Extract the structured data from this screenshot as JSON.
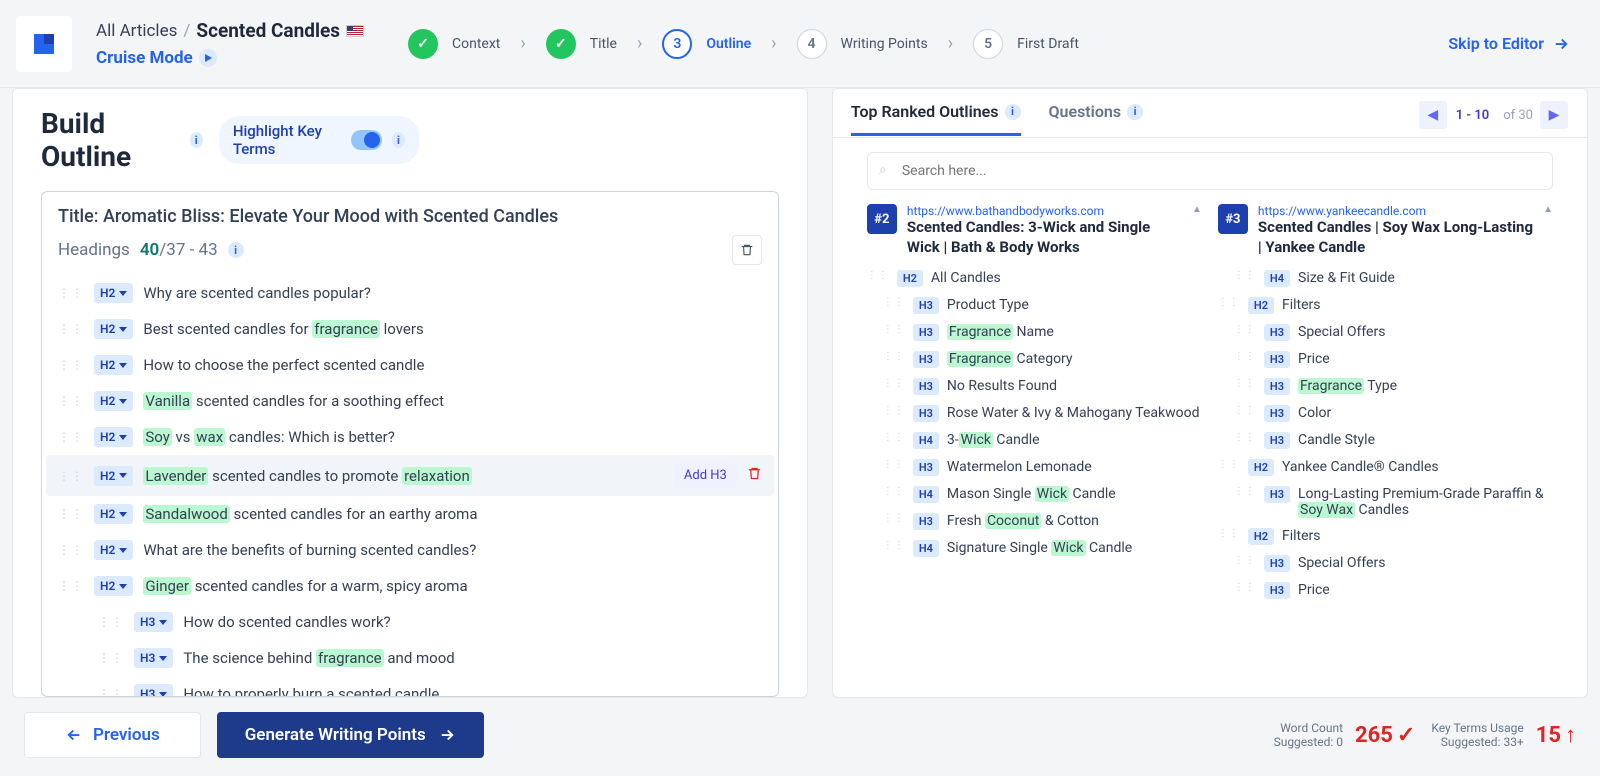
{
  "header": {
    "breadcrumb_root": "All Articles",
    "breadcrumb_title": "Scented Candles",
    "cruise": "Cruise Mode",
    "skip": "Skip to Editor"
  },
  "steps": [
    {
      "label": "Context",
      "state": "done",
      "num": "✓"
    },
    {
      "label": "Title",
      "state": "done",
      "num": "✓"
    },
    {
      "label": "Outline",
      "state": "current",
      "num": "3"
    },
    {
      "label": "Writing Points",
      "state": "pending",
      "num": "4"
    },
    {
      "label": "First Draft",
      "state": "pending",
      "num": "5"
    }
  ],
  "left": {
    "panel_title": "Build Outline",
    "highlight_label": "Highlight Key Terms",
    "article_title": "Title: Aromatic Bliss: Elevate Your Mood with Scented Candles",
    "headings_label": "Headings",
    "headings_count": "40",
    "headings_range": "/37 - 43",
    "add_h3": "Add H3",
    "rows": [
      {
        "level": "H2",
        "indent": 0,
        "parts": [
          {
            "t": "Why are scented candles popular?"
          }
        ]
      },
      {
        "level": "H2",
        "indent": 0,
        "parts": [
          {
            "t": "Best scented candles for "
          },
          {
            "t": "fragrance",
            "hl": true
          },
          {
            "t": " lovers"
          }
        ]
      },
      {
        "level": "H2",
        "indent": 0,
        "parts": [
          {
            "t": "How to choose the perfect scented candle"
          }
        ]
      },
      {
        "level": "H2",
        "indent": 0,
        "parts": [
          {
            "t": "Vanilla",
            "hl": true
          },
          {
            "t": " scented candles for a soothing effect"
          }
        ]
      },
      {
        "level": "H2",
        "indent": 0,
        "parts": [
          {
            "t": "Soy",
            "hl": true
          },
          {
            "t": " vs "
          },
          {
            "t": "wax",
            "hl": true
          },
          {
            "t": " candles: Which is better?"
          }
        ]
      },
      {
        "level": "H2",
        "indent": 0,
        "hover": true,
        "parts": [
          {
            "t": "Lavender",
            "hl": true
          },
          {
            "t": " scented candles to promote "
          },
          {
            "t": "relaxation",
            "hl": true
          }
        ]
      },
      {
        "level": "H2",
        "indent": 0,
        "parts": [
          {
            "t": "Sandalwood",
            "hl": true
          },
          {
            "t": " scented candles for an earthy aroma"
          }
        ]
      },
      {
        "level": "H2",
        "indent": 0,
        "parts": [
          {
            "t": "What are the benefits of burning scented candles?"
          }
        ]
      },
      {
        "level": "H2",
        "indent": 0,
        "parts": [
          {
            "t": "Ginger",
            "hl": true
          },
          {
            "t": " scented candles for a warm, spicy aroma"
          }
        ]
      },
      {
        "level": "H3",
        "indent": 1,
        "parts": [
          {
            "t": "How do scented candles work?"
          }
        ]
      },
      {
        "level": "H3",
        "indent": 1,
        "parts": [
          {
            "t": "The science behind "
          },
          {
            "t": "fragrance",
            "hl": true
          },
          {
            "t": " and mood"
          }
        ]
      },
      {
        "level": "H3",
        "indent": 1,
        "parts": [
          {
            "t": "How to properly burn a scented candle"
          }
        ]
      }
    ]
  },
  "right": {
    "tab_outlines": "Top Ranked Outlines",
    "tab_questions": "Questions",
    "page_range": "1 - 10",
    "page_total": "of 30",
    "search_placeholder": "Search here...",
    "competitors": [
      {
        "rank": "#2",
        "url": "https://www.bathandbodyworks.com",
        "title": "Scented Candles: 3-Wick and Single Wick | Bath & Body Works",
        "rows": [
          {
            "lv": "H2",
            "ind": 1,
            "parts": [
              {
                "t": "All Candles"
              }
            ]
          },
          {
            "lv": "H3",
            "ind": 2,
            "parts": [
              {
                "t": "Product Type"
              }
            ]
          },
          {
            "lv": "H3",
            "ind": 2,
            "parts": [
              {
                "t": "Fragrance",
                "hl": true
              },
              {
                "t": " Name"
              }
            ]
          },
          {
            "lv": "H3",
            "ind": 2,
            "parts": [
              {
                "t": "Fragrance",
                "hl": true
              },
              {
                "t": " Category"
              }
            ]
          },
          {
            "lv": "H3",
            "ind": 2,
            "parts": [
              {
                "t": "No Results Found"
              }
            ]
          },
          {
            "lv": "H3",
            "ind": 2,
            "parts": [
              {
                "t": "Rose Water & Ivy & Mahogany Teakwood"
              }
            ]
          },
          {
            "lv": "H4",
            "ind": 2,
            "parts": [
              {
                "t": "3-"
              },
              {
                "t": "Wick",
                "hl": true
              },
              {
                "t": " Candle"
              }
            ]
          },
          {
            "lv": "H3",
            "ind": 2,
            "parts": [
              {
                "t": "Watermelon Lemonade"
              }
            ]
          },
          {
            "lv": "H4",
            "ind": 2,
            "parts": [
              {
                "t": "Mason Single "
              },
              {
                "t": "Wick",
                "hl": true
              },
              {
                "t": " Candle"
              }
            ]
          },
          {
            "lv": "H3",
            "ind": 2,
            "parts": [
              {
                "t": "Fresh "
              },
              {
                "t": "Coconut",
                "hl": true
              },
              {
                "t": " & Cotton"
              }
            ]
          },
          {
            "lv": "H4",
            "ind": 2,
            "parts": [
              {
                "t": "Signature Single "
              },
              {
                "t": "Wick",
                "hl": true
              },
              {
                "t": " Candle"
              }
            ]
          }
        ]
      },
      {
        "rank": "#3",
        "url": "https://www.yankeecandle.com",
        "title": "Scented Candles | Soy Wax Long-Lasting | Yankee Candle",
        "rows": [
          {
            "lv": "H4",
            "ind": 2,
            "parts": [
              {
                "t": "Size & Fit Guide"
              }
            ]
          },
          {
            "lv": "H2",
            "ind": 1,
            "parts": [
              {
                "t": "Filters"
              }
            ]
          },
          {
            "lv": "H3",
            "ind": 2,
            "parts": [
              {
                "t": "Special Offers"
              }
            ]
          },
          {
            "lv": "H3",
            "ind": 2,
            "parts": [
              {
                "t": "Price"
              }
            ]
          },
          {
            "lv": "H3",
            "ind": 2,
            "parts": [
              {
                "t": "Fragrance",
                "hl": true
              },
              {
                "t": " Type"
              }
            ]
          },
          {
            "lv": "H3",
            "ind": 2,
            "parts": [
              {
                "t": "Color"
              }
            ]
          },
          {
            "lv": "H3",
            "ind": 2,
            "parts": [
              {
                "t": "Candle Style"
              }
            ]
          },
          {
            "lv": "H2",
            "ind": 1,
            "parts": [
              {
                "t": "Yankee Candle® Candles"
              }
            ]
          },
          {
            "lv": "H3",
            "ind": 2,
            "parts": [
              {
                "t": "Long-Lasting Premium-Grade Paraffin & "
              },
              {
                "t": "Soy Wax",
                "hl": true
              },
              {
                "t": " Candles"
              }
            ]
          },
          {
            "lv": "H2",
            "ind": 1,
            "parts": [
              {
                "t": "Filters"
              }
            ]
          },
          {
            "lv": "H3",
            "ind": 2,
            "parts": [
              {
                "t": "Special Offers"
              }
            ]
          },
          {
            "lv": "H3",
            "ind": 2,
            "parts": [
              {
                "t": "Price"
              }
            ]
          }
        ]
      }
    ]
  },
  "footer": {
    "previous": "Previous",
    "generate": "Generate Writing Points",
    "word_count_label": "Word Count",
    "word_count_sub": "Suggested: 0",
    "word_count": "265",
    "key_terms_label": "Key Terms Usage",
    "key_terms_sub": "Suggested: 33+",
    "key_terms": "15"
  }
}
